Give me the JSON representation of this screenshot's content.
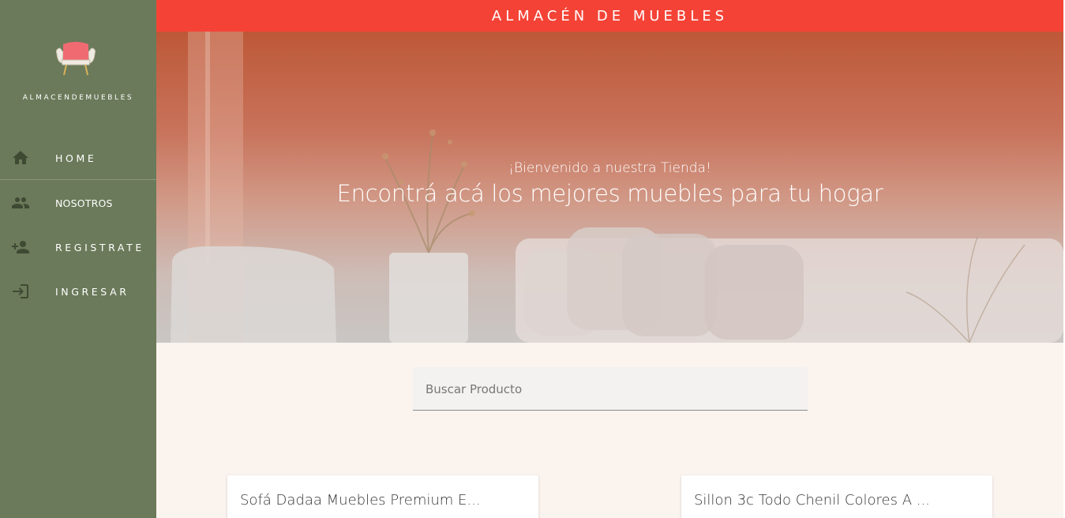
{
  "app": {
    "title": "ALMACÉN DE MUEBLES"
  },
  "sidebar": {
    "brand": "ALMACENDEMUEBLES",
    "logo_icon": "armchair-icon",
    "items": [
      {
        "label": "HOME",
        "icon": "home-icon"
      },
      {
        "label": "NOSOTROS",
        "icon": "people-icon"
      },
      {
        "label": "REGISTRATE",
        "icon": "person-add-icon"
      },
      {
        "label": "INGRESAR",
        "icon": "login-icon"
      }
    ]
  },
  "hero": {
    "subtitle": "¡Bienvenido a nuestra Tienda!",
    "title": "Encontrá acá los mejores muebles para tu hogar"
  },
  "search": {
    "placeholder": "Buscar Producto",
    "value": ""
  },
  "products": [
    {
      "title": "Sofá Dadaa Muebles Premium E...",
      "price": ""
    },
    {
      "title": "Sillon 3c Todo Chenil Colores A ...",
      "price": ""
    }
  ],
  "colors": {
    "sidebar": "#6b7a5a",
    "topbar": "#f44336",
    "page_background": "#faf3ee",
    "logo_seat": "#f06a72"
  }
}
